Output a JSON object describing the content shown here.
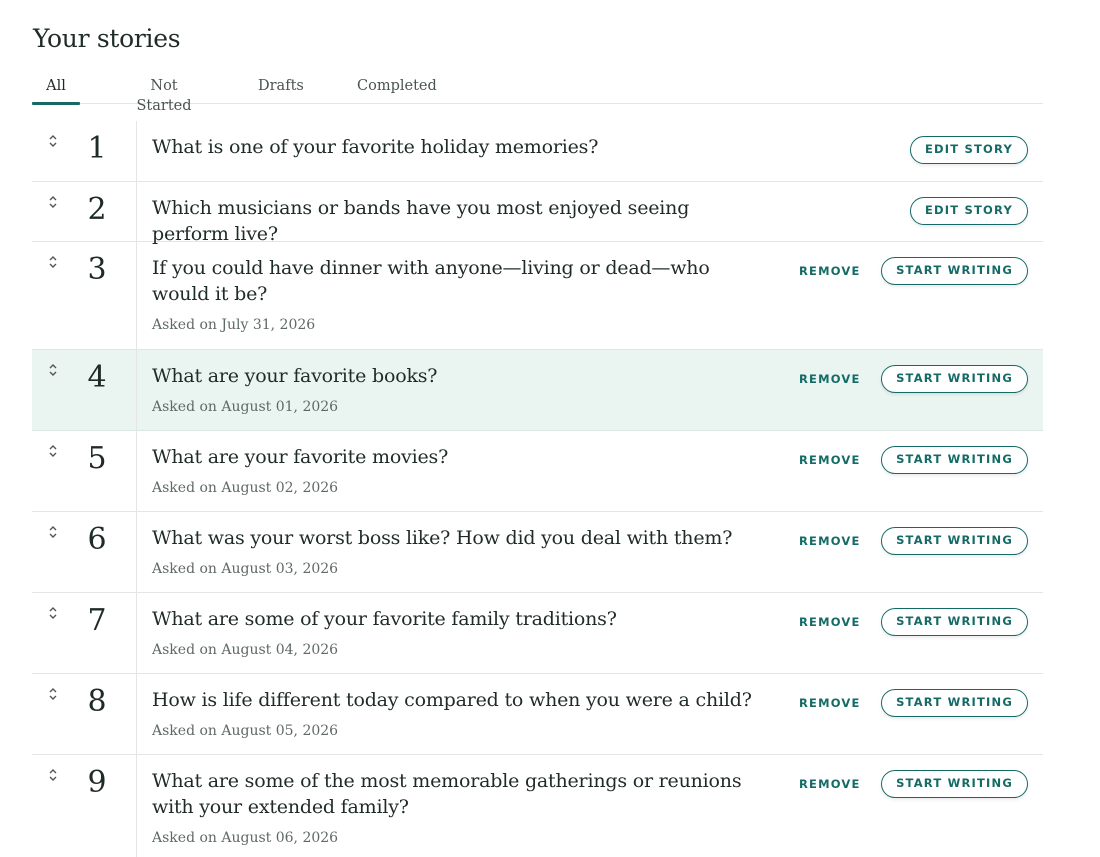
{
  "page": {
    "title": "Your stories"
  },
  "tabs": [
    {
      "label": "All",
      "active": true
    },
    {
      "label": "Not Started",
      "active": false
    },
    {
      "label": "Drafts",
      "active": false
    },
    {
      "label": "Completed",
      "active": false
    }
  ],
  "actions": {
    "remove_label": "REMOVE"
  },
  "colors": {
    "accent": "#146b66",
    "highlight_row": "#eaf4f1",
    "text": "#1f2b27"
  },
  "stories": [
    {
      "number": "1",
      "question": "What is one of your favorite holiday memories?",
      "asked": "",
      "action": "EDIT STORY",
      "removable": false
    },
    {
      "number": "2",
      "question": "Which musicians or bands have you most enjoyed seeing perform live?",
      "asked": "",
      "action": "EDIT STORY",
      "removable": false
    },
    {
      "number": "3",
      "question": "If you could have dinner with anyone—living or dead—who would it be?",
      "asked": "Asked on July 31, 2026",
      "action": "START WRITING",
      "removable": true
    },
    {
      "number": "4",
      "question": "What are your favorite books?",
      "asked": "Asked on August 01, 2026",
      "action": "START WRITING",
      "removable": true,
      "highlighted": true
    },
    {
      "number": "5",
      "question": "What are your favorite movies?",
      "asked": "Asked on August 02, 2026",
      "action": "START WRITING",
      "removable": true
    },
    {
      "number": "6",
      "question": "What was your worst boss like? How did you deal with them?",
      "asked": "Asked on August 03, 2026",
      "action": "START WRITING",
      "removable": true
    },
    {
      "number": "7",
      "question": "What are some of your favorite family traditions?",
      "asked": "Asked on August 04, 2026",
      "action": "START WRITING",
      "removable": true
    },
    {
      "number": "8",
      "question": "How is life different today compared to when you were a child?",
      "asked": "Asked on August 05, 2026",
      "action": "START WRITING",
      "removable": true
    },
    {
      "number": "9",
      "question": "What are some of the most memorable gatherings or reunions with your extended family?",
      "asked": "Asked on August 06, 2026",
      "action": "START WRITING",
      "removable": true
    }
  ]
}
